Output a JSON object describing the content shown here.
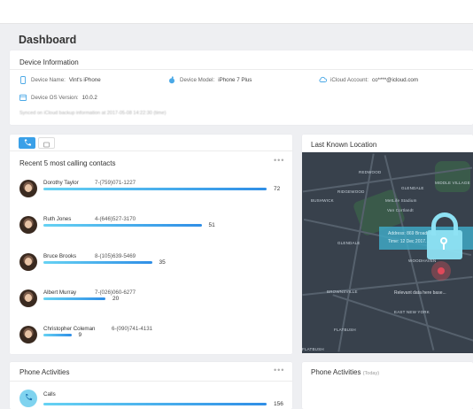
{
  "header": {
    "title": "Dashboard"
  },
  "device_info": {
    "title": "Device Information",
    "device_name_label": "Device Name:",
    "device_name": "Vint's iPhone",
    "device_model_label": "Device Model:",
    "device_model": "iPhone 7 Plus",
    "icloud_label": "iCloud Account:",
    "icloud_value": "co****@icloud.com",
    "os_label": "Device OS Version:",
    "os_value": "10.0.2",
    "blurred_note": "Synced on iCloud backup information at 2017-05-08 14:22:30 (time)"
  },
  "contacts_card": {
    "title": "Recent 5 most calling contacts",
    "more": "•••",
    "contacts": [
      {
        "name": "Dorothy Taylor",
        "phone": "7-(759)071-1227",
        "count": "72",
        "value": 72
      },
      {
        "name": "Ruth Jones",
        "phone": "4-(646)527-3170",
        "count": "51",
        "value": 51
      },
      {
        "name": "Bruce Brooks",
        "phone": "8-(105)639-5469",
        "count": "35",
        "value": 35
      },
      {
        "name": "Albert Murray",
        "phone": "7-(026)060-6277",
        "count": "20",
        "value": 20
      },
      {
        "name": "Christopher Coleman",
        "phone": "6-(090)741-4131",
        "count": "9",
        "value": 9
      }
    ]
  },
  "location_card": {
    "title": "Last Known Location",
    "callout_line1": "Address: 869 Broadway...",
    "callout_line2": "Time: 12 Dec 2017...",
    "note": "Relevant data here base...",
    "labels": [
      "REDWOOD",
      "GLENDALE",
      "MIDDLE VILLAGE",
      "RIDGEWOOD",
      "BUSHWICK",
      "MetLife Stadium",
      "Van Cortlandt",
      "GLENDALE",
      "WOODHAVEN",
      "BROWNSVILLE",
      "EAST NEW YORK",
      "FLATBUSH",
      "FLATBUSH"
    ]
  },
  "phone_activities": {
    "title": "Phone Activities",
    "more": "•••",
    "calls_label": "Calls",
    "calls_count": "156",
    "calls_value": 156
  },
  "phone_activities_today": {
    "title": "Phone Activities",
    "subtitle": "(Today)"
  },
  "colors": {
    "accent": "#3aa0e8",
    "bar_start": "#66d2f3",
    "bar_end": "#2f8ee6",
    "map_bg": "#38414c",
    "lock": "#8ee1f3"
  }
}
